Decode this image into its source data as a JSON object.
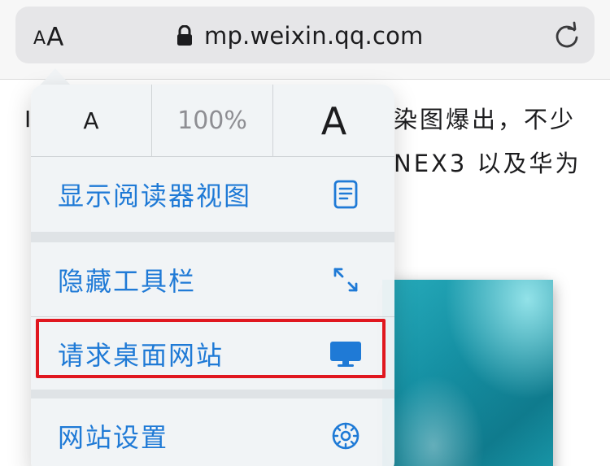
{
  "address_bar": {
    "text_size_small": "A",
    "text_size_large": "A",
    "url": "mp.weixin.qq.com"
  },
  "article": {
    "line1": "染图爆出，不少",
    "line2": "NEX3 以及华为",
    "left_fragment": "I"
  },
  "popover": {
    "font_smaller": "A",
    "zoom_level": "100%",
    "font_larger": "A",
    "items": [
      {
        "label": "显示阅读器视图",
        "icon": "reader-view-icon"
      },
      {
        "label": "隐藏工具栏",
        "icon": "expand-arrows-icon"
      },
      {
        "label": "请求桌面网站",
        "icon": "desktop-icon"
      },
      {
        "label": "网站设置",
        "icon": "gear-icon"
      }
    ]
  },
  "colors": {
    "accent": "#1f7ad6",
    "highlight_border": "#e0171f",
    "image_teal": "#168fa2"
  }
}
